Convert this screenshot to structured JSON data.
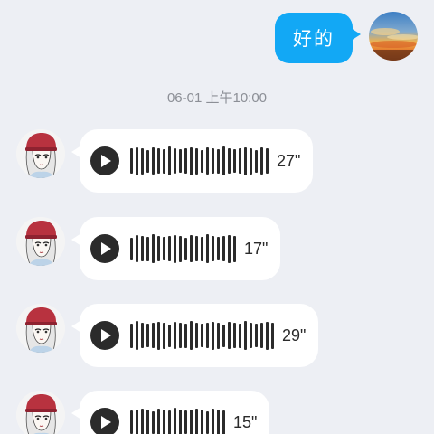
{
  "outgoing": {
    "text": "好的"
  },
  "timestamp": "06-01 上午10:00",
  "voice_messages": [
    {
      "duration": "27\"",
      "bars": 26
    },
    {
      "duration": "17\"",
      "bars": 20
    },
    {
      "duration": "29\"",
      "bars": 27
    },
    {
      "duration": "15\"",
      "bars": 18
    }
  ],
  "colors": {
    "background": "#edeff4",
    "outgoing_bubble": "#12a8f5",
    "incoming_bubble": "#ffffff",
    "icon": "#2b2b2b"
  },
  "icons": {
    "play": "play-icon",
    "waveform": "waveform-icon"
  }
}
